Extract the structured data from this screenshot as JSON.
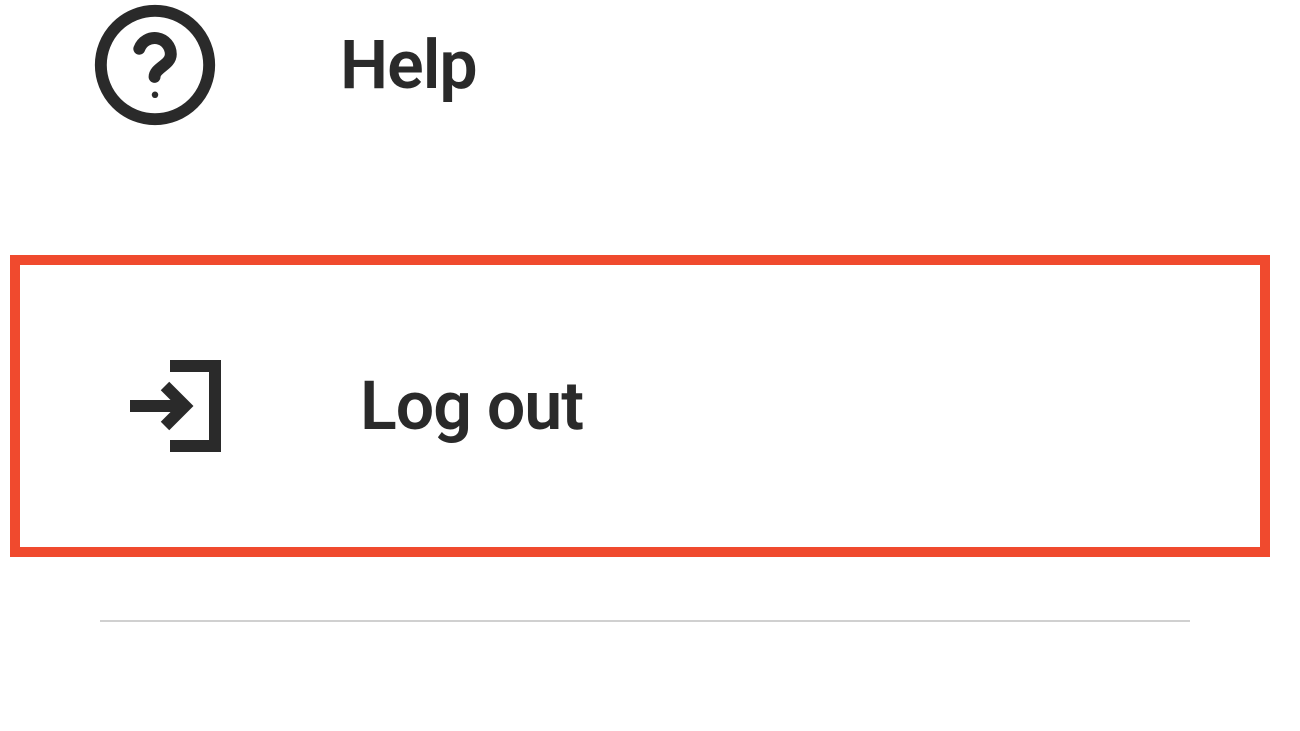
{
  "menu": {
    "help": {
      "label": "Help",
      "icon": "help-circle-icon"
    },
    "logout": {
      "label": "Log out",
      "icon": "logout-icon",
      "highlighted": true
    }
  },
  "colors": {
    "highlight_border": "#f04a2e",
    "icon_stroke": "#2a2a2a",
    "text": "#2a2a2a",
    "divider": "#d0d0d0"
  }
}
